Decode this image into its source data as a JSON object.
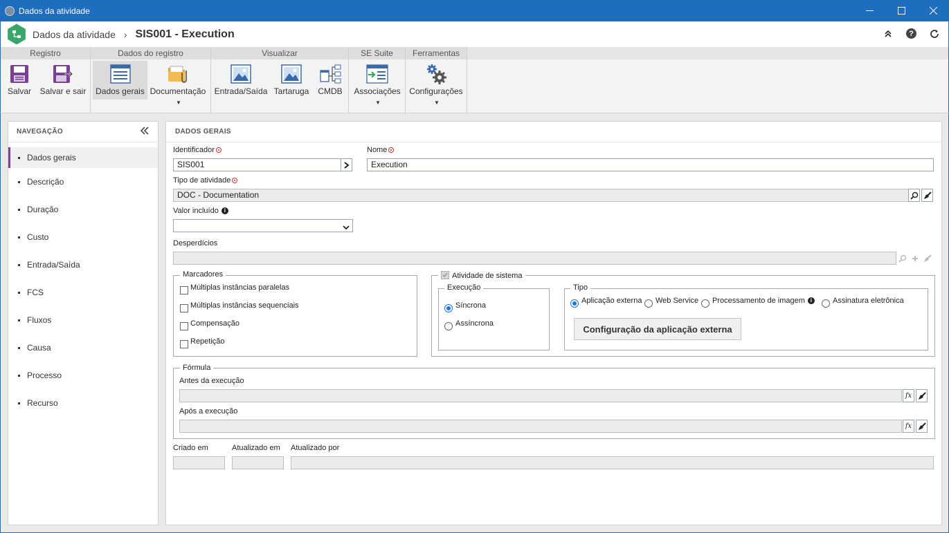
{
  "window": {
    "title": "Dados da atividade"
  },
  "header": {
    "crumb": "Dados da atividade",
    "separator": "›",
    "title": "SIS001 - Execution"
  },
  "ribbon": {
    "groups": {
      "registro": "Registro",
      "dados_registro": "Dados do registro",
      "visualizar": "Visualizar",
      "se_suite": "SE Suite",
      "ferramentas": "Ferramentas"
    },
    "buttons": {
      "salvar": "Salvar",
      "salvar_sair": "Salvar e sair",
      "dados_gerais": "Dados gerais",
      "documentacao": "Documentação",
      "entrada_saida": "Entrada/Saída",
      "tartaruga": "Tartaruga",
      "cmdb": "CMDB",
      "associacoes": "Associações",
      "configuracoes": "Configurações"
    }
  },
  "nav": {
    "title": "NAVEGAÇÃO",
    "items": [
      "Dados gerais",
      "Descrição",
      "Duração",
      "Custo",
      "Entrada/Saída",
      "FCS",
      "Fluxos",
      "Causa",
      "Processo",
      "Recurso"
    ]
  },
  "panel": {
    "title": "DADOS GERAIS",
    "identificador": {
      "label": "Identificador",
      "value": "SIS001"
    },
    "nome": {
      "label": "Nome",
      "value": "Execution"
    },
    "tipo_atividade": {
      "label": "Tipo de atividade",
      "value": "DOC - Documentation"
    },
    "valor_incluido": {
      "label": "Valor incluído",
      "value": ""
    },
    "desperdicios": {
      "label": "Desperdícios",
      "value": ""
    },
    "marcadores": {
      "label": "Marcadores",
      "options": [
        "Múltiplas instâncias paralelas",
        "Múltiplas instâncias sequenciais",
        "Compensação",
        "Repetição"
      ]
    },
    "atividade_sistema": {
      "label": "Atividade de sistema",
      "checked": true
    },
    "execucao": {
      "label": "Execução",
      "options": [
        "Síncrona",
        "Assíncrona"
      ],
      "selected": "Síncrona"
    },
    "tipo": {
      "label": "Tipo",
      "options": [
        "Aplicação externa",
        "Web Service",
        "Processamento de imagem",
        "Assinatura eletrônica"
      ],
      "selected": "Aplicação externa",
      "config_button": "Configuração da aplicação externa"
    },
    "formula": {
      "label": "Fórmula",
      "antes_label": "Antes da execução",
      "apos_label": "Após a execução",
      "fx": "fx"
    },
    "criado_em": {
      "label": "Criado em",
      "value": ""
    },
    "atualizado_em": {
      "label": "Atualizado em",
      "value": ""
    },
    "atualizado_por": {
      "label": "Atualizado por",
      "value": ""
    }
  },
  "colors": {
    "titlebar": "#1e6dbf",
    "accent": "#7b3f98",
    "radio": "#1a73e8",
    "required": "#c9302c"
  }
}
